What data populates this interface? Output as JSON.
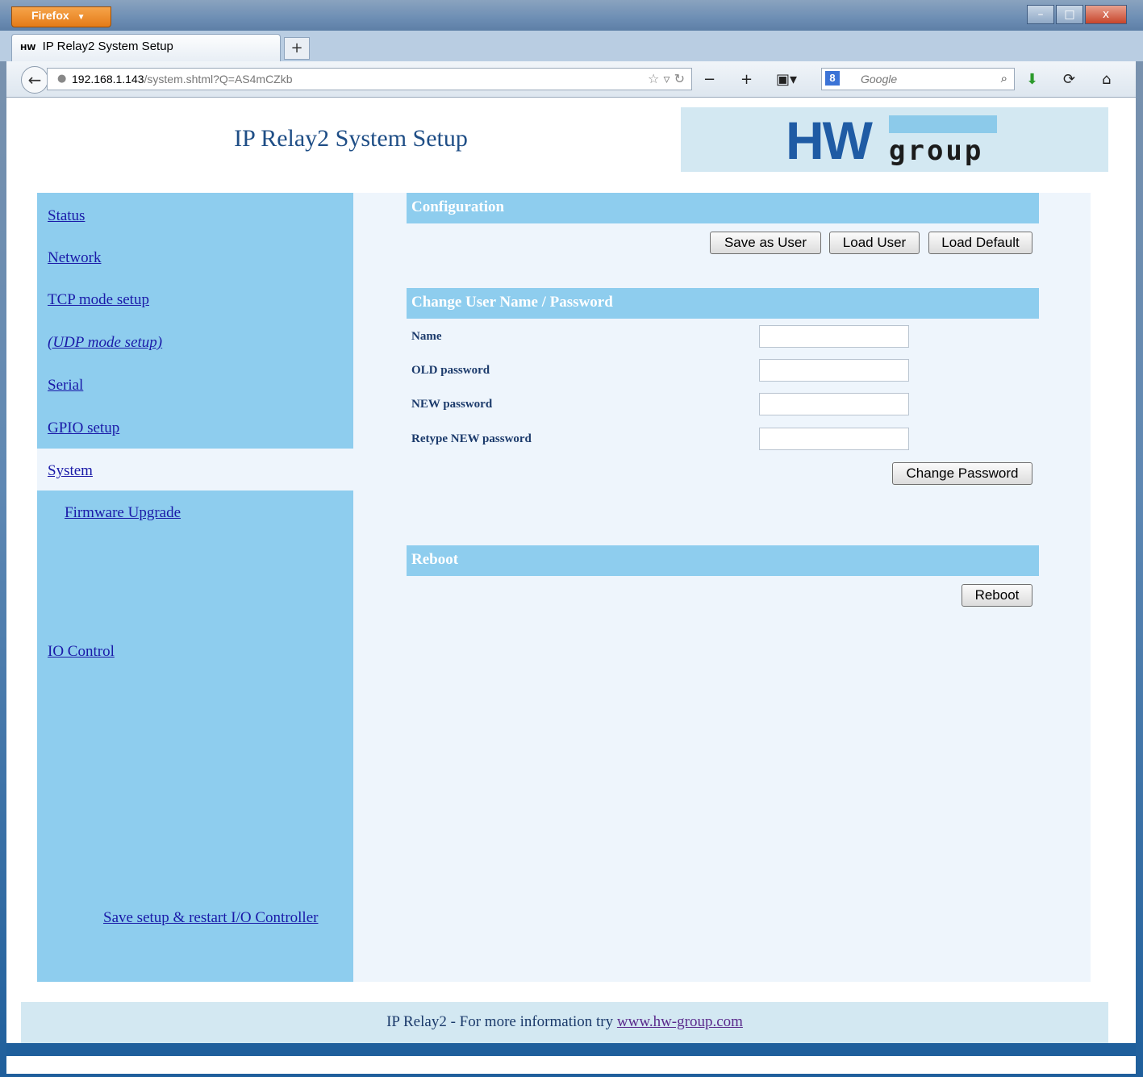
{
  "browser": {
    "app_button": "Firefox",
    "tab_title": "IP Relay2 System Setup",
    "tab_favicon": "HW",
    "url_host": "192.168.1.143",
    "url_path": "/system.shtml?Q=AS4mCZkb",
    "search_placeholder": "Google",
    "window_controls": [
      "–",
      "□",
      "x"
    ]
  },
  "header": {
    "title": "IP Relay2 System Setup",
    "logo_hw": "HW",
    "logo_group": "group"
  },
  "sidebar": {
    "items": [
      {
        "label": "Status"
      },
      {
        "label": "Network"
      },
      {
        "label": "TCP mode setup"
      },
      {
        "label": "(UDP mode setup)"
      },
      {
        "label": "Serial"
      },
      {
        "label": "GPIO setup"
      },
      {
        "label": "System"
      },
      {
        "label": "Firmware Upgrade"
      },
      {
        "label": "IO Control"
      }
    ],
    "save_restart": "Save setup & restart I/O Controller"
  },
  "configuration": {
    "title": "Configuration",
    "save_user": "Save as User",
    "load_user": "Load User",
    "load_default": "Load Default"
  },
  "credentials": {
    "title": "Change User Name / Password",
    "name_label": "Name",
    "old_label": "OLD password",
    "new_label": "NEW password",
    "retype_label": "Retype NEW password",
    "name_value": "",
    "old_value": "",
    "new_value": "",
    "retype_value": "",
    "change_button": "Change Password"
  },
  "reboot": {
    "title": "Reboot",
    "button": "Reboot"
  },
  "footer": {
    "text": "IP Relay2 - For more information try ",
    "link": "www.hw-group.com"
  },
  "colors": {
    "sidebar_bg": "#8ecdee",
    "section_head": "#8ecdee",
    "content_bg": "#eef5fc",
    "link": "#1a1aa8",
    "title_text": "#1f4e86"
  }
}
